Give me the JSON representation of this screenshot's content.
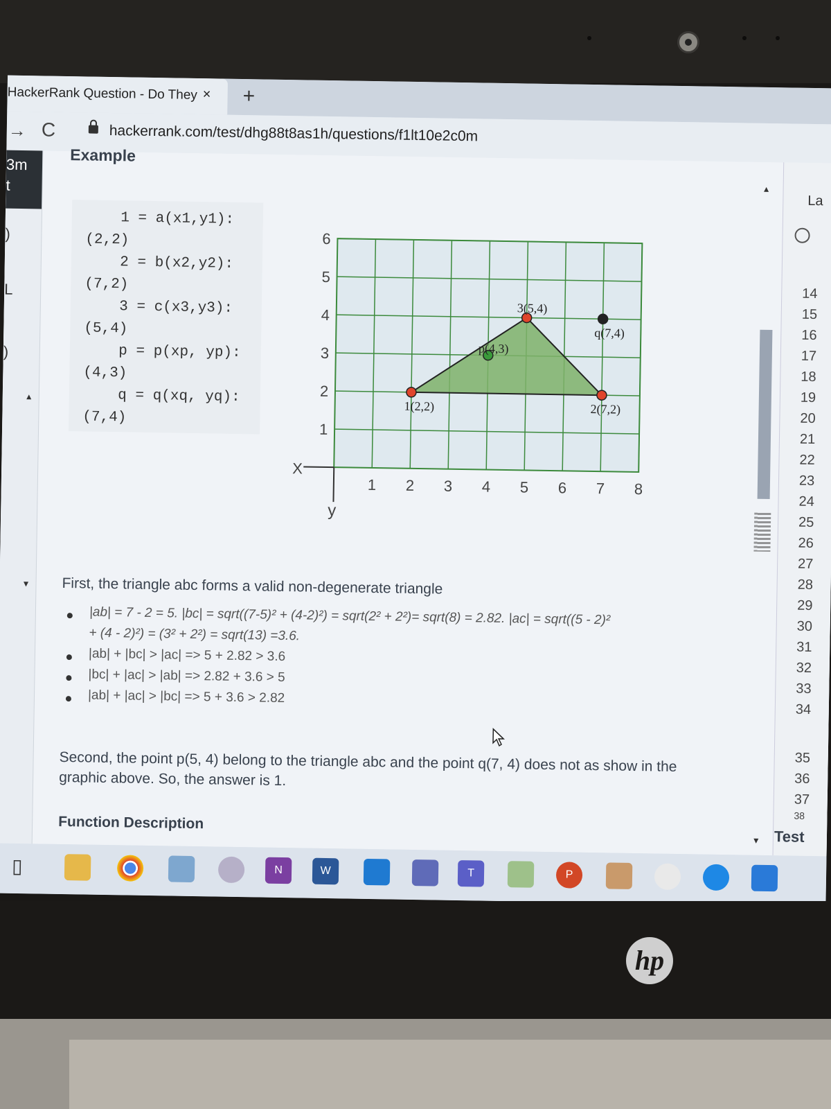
{
  "browser": {
    "tab_title": "HackerRank Question - Do They",
    "tab_close": "×",
    "new_tab": "+",
    "back": "→",
    "reload": "C",
    "url": "hackerrank.com/test/dhg88t8as1h/questions/f1lt10e2c0m"
  },
  "left_nav": {
    "timer_top": "3m",
    "timer_bottom": "t",
    "mark_1": ")",
    "mark_2": "L",
    "mark_3": ")",
    "arrow_up": "▲",
    "arrow_down": "▼"
  },
  "question": {
    "example_heading": "Example",
    "code_lines": [
      "    1 = a(x1,y1):",
      "(2,2)",
      "    2 = b(x2,y2):",
      "(7,2)",
      "    3 = c(x3,y3):",
      "(5,4)",
      "    p = p(xp, yp):",
      "(4,3)",
      "    q = q(xq, yq):",
      "(7,4)"
    ],
    "graph": {
      "x_axis_label": "X",
      "y_axis_label": "y",
      "x_ticks": [
        "1",
        "2",
        "3",
        "4",
        "5",
        "6",
        "7",
        "8"
      ],
      "y_ticks": [
        "1",
        "2",
        "3",
        "4",
        "5",
        "6"
      ],
      "triangle_color": "#7fb26a",
      "vertex_color": "#e0452c",
      "points": [
        {
          "label": "1(2,2)",
          "x": 2,
          "y": 2
        },
        {
          "label": "2(7,2)",
          "x": 7,
          "y": 2
        },
        {
          "label": "3(5,4)",
          "x": 5,
          "y": 4
        },
        {
          "label": "p(4,3)",
          "x": 4,
          "y": 3
        },
        {
          "label": "q(7,4)",
          "x": 7,
          "y": 4
        }
      ]
    },
    "line_1": "First, the triangle abc forms a valid non-degenerate triangle",
    "bullets": [
      "|ab| = 7 - 2 = 5. |bc| = sqrt((7-5)² + (4-2)²) = sqrt(2² + 2²)= sqrt(8) = 2.82. |ac| = sqrt((5 - 2)²",
      "+ (4 - 2)²) = (3² + 2²) = sqrt(13) =3.6.",
      "|ab| + |bc| > |ac| => 5 + 2.82 > 3.6",
      "|bc| + |ac| > |ab| => 2.82 + 3.6 > 5",
      "|ab| + |ac| > |bc| => 5 + 3.6 > 2.82"
    ],
    "line_2": "Second, the point p(5, 4) belong to the triangle abc and the point q(7, 4) does not as show in the graphic above. So, the answer is 1.",
    "function_heading": "Function Description"
  },
  "editor": {
    "language_partial": "La",
    "line_numbers": [
      "14",
      "15",
      "16",
      "17",
      "18",
      "19",
      "20",
      "21",
      "22",
      "23",
      "24",
      "25",
      "26",
      "27",
      "28",
      "29",
      "30",
      "31",
      "32",
      "33",
      "34",
      "35",
      "36",
      "37",
      "38"
    ],
    "test_label": "Test"
  },
  "taskbar": {
    "apps": [
      "task-view",
      "file-explorer",
      "chrome",
      "photos",
      "paint",
      "onenote",
      "word",
      "vscode",
      "teams-alt",
      "teams",
      "notepad",
      "powerpoint",
      "image-viewer",
      "browser-extra",
      "edge",
      "photos-2"
    ],
    "onenote_letter": "N",
    "word_letter": "W",
    "teams_letter": "T",
    "powerpoint_letter": "P"
  },
  "laptop": {
    "logo_text": "hp"
  }
}
